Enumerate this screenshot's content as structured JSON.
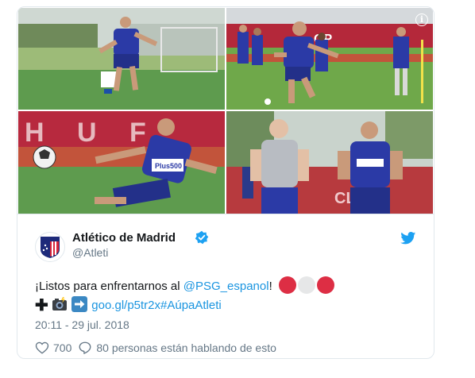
{
  "tweet": {
    "display_name": "Atlético de Madrid",
    "handle": "@Atleti",
    "text_prefix": "¡Listos para enfrentarnos al ",
    "mention": "@PSG_espanol",
    "text_after_mention": "!",
    "link": "goo.gl/p5tr2x",
    "hashtag": "#AúpaAtleti",
    "timestamp": "20:11 - 29 jul. 2018",
    "likes": "700",
    "replies_text": "80 personas están hablando de esto",
    "emoji": [
      "red-circle",
      "white-circle",
      "red-circle",
      "heavy-plus",
      "camera-flash",
      "right-arrow"
    ]
  },
  "photo_banner_text": {
    "p2_sign": "OP",
    "p3_sign": "H   U   F",
    "p4_sign": "CLU",
    "jersey_sponsor": "Plus500"
  },
  "icons": {
    "info": "info-icon",
    "verified": "verified-badge-icon",
    "twitter": "twitter-bird-icon",
    "like": "heart-icon",
    "reply": "reply-bubble-icon",
    "club": "atletico-crest-icon"
  },
  "colors": {
    "accent": "#1b95e0",
    "text": "#14171a",
    "muted": "#657786",
    "jersey": "#2b3aa6",
    "red": "#d9263b"
  }
}
